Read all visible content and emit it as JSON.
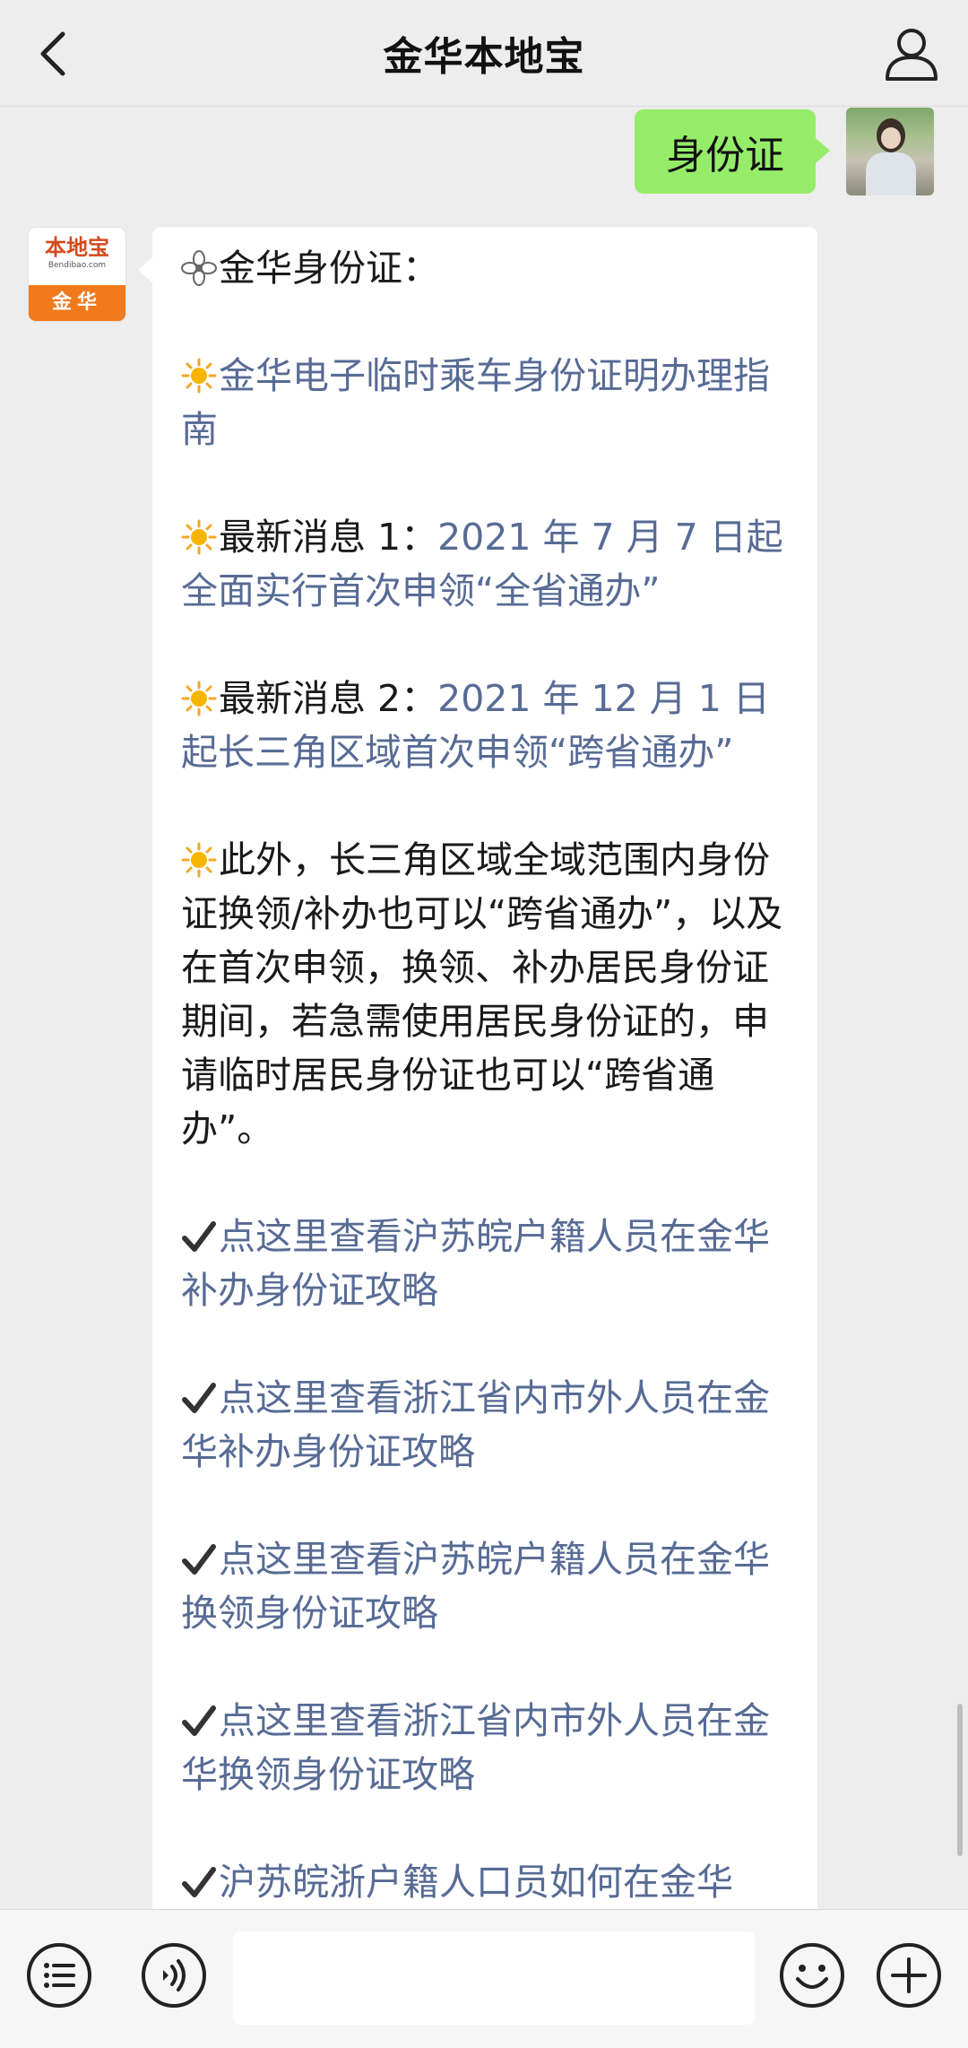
{
  "header": {
    "title": "金华本地宝"
  },
  "user_message": {
    "text": "身份证"
  },
  "bot_avatar": {
    "brand": "本地宝",
    "domain": "Bendibao.com",
    "city": "金华"
  },
  "bot_message": {
    "heading": "金华身份证：",
    "items": [
      {
        "plain": "",
        "link": "金华电子临时乘车身份证明办理指南"
      },
      {
        "plain": "最新消息 1：",
        "link": "2021 年 7 月 7 日起全面实行首次申领“全省通办”"
      },
      {
        "plain": "最新消息 2：",
        "link": "2021 年 12 月 1 日起长三角区域首次申领“跨省通办”"
      },
      {
        "plain": "此外，长三角区域全域范围内身份证换领/补办也可以“跨省通办”，以及在首次申领，换领、补办居民身份证期间，若急需使用居民身份证的，申请临时居民身份证也可以“跨省通办”。",
        "link": ""
      }
    ],
    "links": [
      "点这里查看沪苏皖户籍人员在金华补办身份证攻略",
      "点这里查看浙江省内市外人员在金华补办身份证攻略",
      "点这里查看沪苏皖户籍人员在金华换领身份证攻略",
      "点这里查看浙江省内市外人员在金华换领身份证攻略",
      "沪苏皖浙户籍人口员如何在金华"
    ]
  },
  "icons": {
    "header_left": "back-arrow-icon",
    "header_right": "user-profile-icon",
    "heading_marker": "flower-icon",
    "item_marker": "sun-icon",
    "link_marker": "checkmark-icon",
    "toolbar": [
      "menu-list-icon",
      "voice-icon",
      "emoji-icon",
      "plus-icon"
    ]
  },
  "colors": {
    "background": "#ededed",
    "user_bubble": "#95ec69",
    "bot_bubble": "#ffffff",
    "link": "#576b95",
    "sun": "#f5a623",
    "brand_orange": "#f07a1c"
  }
}
